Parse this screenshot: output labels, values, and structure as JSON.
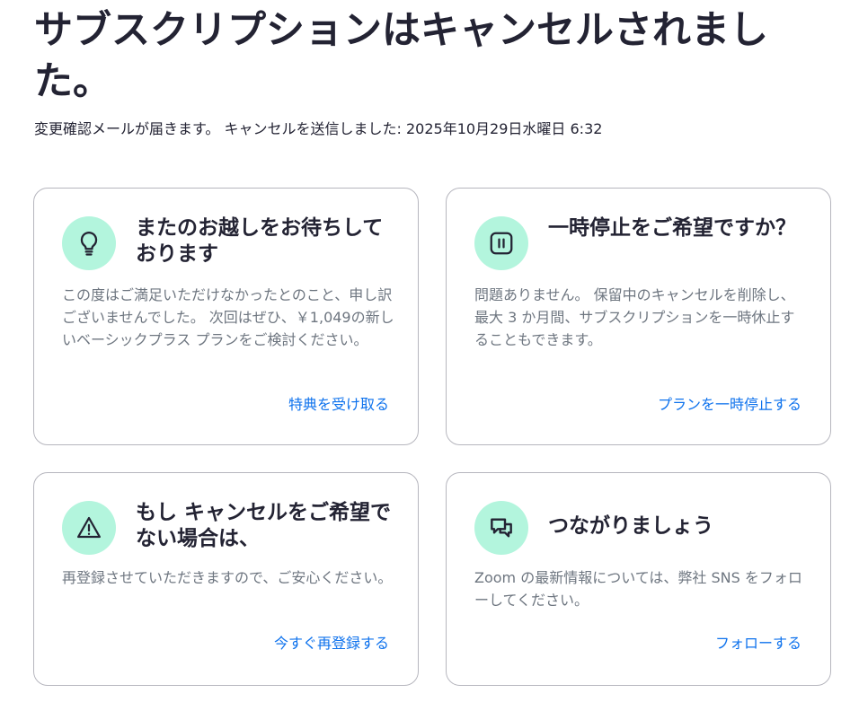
{
  "page": {
    "title": "サブスクリプションはキャンセルされました。",
    "subtitle_prefix": "変更確認メールが届きます。 キャンセルを送信しました: ",
    "timestamp": "2025年10月29日水曜日 6:32"
  },
  "cards": [
    {
      "icon": "lightbulb-icon",
      "title": "またのお越しをお待ちしております",
      "body": "この度はご満足いただけなかったとのこと、申し訳ございませんでした。 次回はぜひ、￥1,049の新しいベーシックプラス プランをご検討ください。",
      "link": "特典を受け取る"
    },
    {
      "icon": "pause-icon",
      "title": "一時停止をご希望ですか？",
      "body": "問題ありません。 保留中のキャンセルを削除し、最大 3 か月間、サブスクリプションを一時休止することもできます。",
      "link": "プランを一時停止する"
    },
    {
      "icon": "warning-icon",
      "title": "もし キャンセルをご希望でない場合は、",
      "body": "再登録させていただきますので、ご安心ください。",
      "link": "今すぐ再登録する"
    },
    {
      "icon": "chat-bubbles-icon",
      "title": "つながりましょう",
      "body": "Zoom の最新情報については、弊社 SNS をフォローしてください。",
      "link": "フォローする"
    }
  ],
  "colors": {
    "icon_bg": "#b3f5dd",
    "link": "#0e72ed",
    "body_text": "#6e7680",
    "title_text": "#232333"
  }
}
